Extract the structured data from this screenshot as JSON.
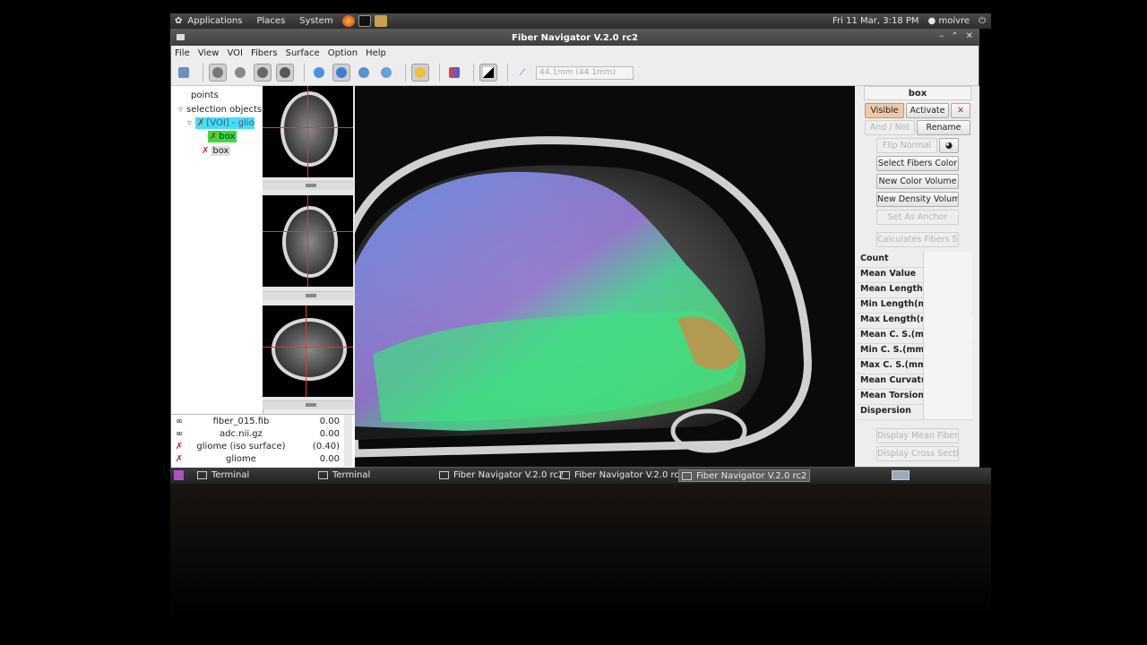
{
  "top_panel": {
    "menus": [
      "Applications",
      "Places",
      "System"
    ],
    "clock": "Fri 11 Mar,  3:18 PM",
    "user": "moivre"
  },
  "window": {
    "title": "Fiber Navigator V.2.0 rc2",
    "menus": [
      "File",
      "View",
      "VOI",
      "Fibers",
      "Surface",
      "Option",
      "Help"
    ],
    "measure_text": "44.1mm (44.1mm)"
  },
  "tree": {
    "items": [
      {
        "label": "points"
      },
      {
        "label": "selection objects"
      },
      {
        "label": "[VOI] - gliom"
      },
      {
        "label": "box"
      },
      {
        "label": "box"
      }
    ],
    "colors": {
      "selected_bg": "#3ee0ff",
      "child_bg": "#33e033"
    }
  },
  "datasets": [
    {
      "icon": "glasses-icon",
      "name": "fiber_015.fib",
      "value": "0.00"
    },
    {
      "icon": "glasses-icon",
      "name": "adc.nii.gz",
      "value": "0.00"
    },
    {
      "icon": "x-icon",
      "name": "gliome (iso surface)",
      "value": "(0.40)"
    },
    {
      "icon": "x-icon",
      "name": "gliome",
      "value": "0.00"
    }
  ],
  "props": {
    "title": "box",
    "visible": "Visible",
    "activate": "Activate",
    "and_not": "And / Not",
    "rename": "Rename",
    "flip_normal": "Flip Normal",
    "select_fibers_color": "Select Fibers Color",
    "new_color_volume": "New Color Volume",
    "new_density_volume": "New Density Volum",
    "set_as_anchor": "Set As Anchor",
    "calculate_fibers": "Calculates Fibers St",
    "stats": [
      "Count",
      "Mean Value",
      "Mean Length(",
      "Min Length(m",
      "Max Length(m",
      "Mean C. S.(mm",
      "Min C. S.(mm)",
      "Max C. S.(mm",
      "Mean Curvatu",
      "Mean Torsion",
      "Dispersion"
    ],
    "display_mean_fiber": "Display Mean Fiber",
    "display_cross_section": "Display Cross Secti"
  },
  "taskbar": {
    "tasks": [
      "Terminal",
      "Terminal",
      "Fiber Navigator V.2.0 rc2",
      "Fiber Navigator V.2.0 rc2",
      "Fiber Navigator V.2.0 rc2"
    ]
  }
}
